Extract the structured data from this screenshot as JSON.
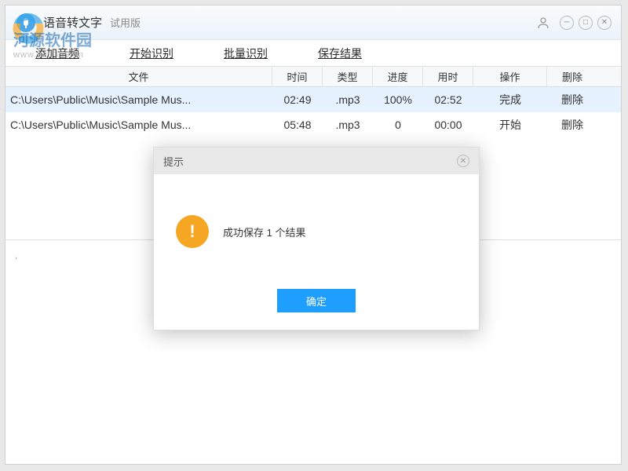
{
  "titlebar": {
    "title": "语音转文字",
    "trial": "试用版"
  },
  "watermark": {
    "name": "河源软件园",
    "url": "www.pc0359.cn"
  },
  "toolbar": {
    "add": "添加音频",
    "start": "开始识别",
    "batch": "批量识别",
    "save": "保存结果"
  },
  "table": {
    "headers": {
      "file": "文件",
      "time": "时间",
      "type": "类型",
      "progress": "进度",
      "duration": "用时",
      "action": "操作",
      "delete": "删除"
    },
    "rows": [
      {
        "file": "C:\\Users\\Public\\Music\\Sample Mus...",
        "time": "02:49",
        "type": ".mp3",
        "progress": "100%",
        "duration": "02:52",
        "action": "完成",
        "delete": "删除"
      },
      {
        "file": "C:\\Users\\Public\\Music\\Sample Mus...",
        "time": "05:48",
        "type": ".mp3",
        "progress": "0",
        "duration": "00:00",
        "action": "开始",
        "delete": "删除"
      }
    ]
  },
  "content_placeholder": ",",
  "dialog": {
    "title": "提示",
    "message": "成功保存 1 个结果",
    "ok": "确定"
  }
}
